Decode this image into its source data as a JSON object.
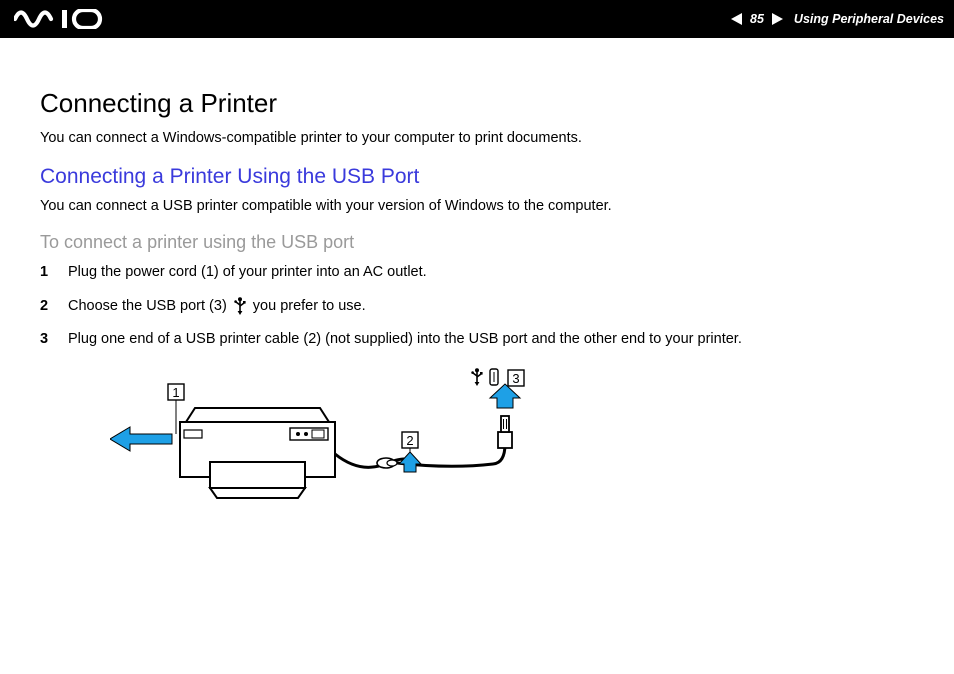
{
  "header": {
    "page_number": "85",
    "section": "Using Peripheral Devices"
  },
  "page": {
    "title": "Connecting a Printer",
    "intro": "You can connect a Windows-compatible printer to your computer to print documents.",
    "subtitle": "Connecting a Printer Using the USB Port",
    "sub_intro": "You can connect a USB printer compatible with your version of Windows to the computer.",
    "procedure_title": "To connect a printer using the USB port",
    "steps": [
      {
        "n": "1",
        "text": "Plug the power cord (1) of your printer into an AC outlet."
      },
      {
        "n": "2",
        "text_before": "Choose the USB port (3)",
        "text_after": "you prefer to use."
      },
      {
        "n": "3",
        "text": "Plug one end of a USB printer cable (2) (not supplied) into the USB port and the other end to your printer."
      }
    ],
    "callouts": {
      "c1": "1",
      "c2": "2",
      "c3": "3"
    }
  }
}
